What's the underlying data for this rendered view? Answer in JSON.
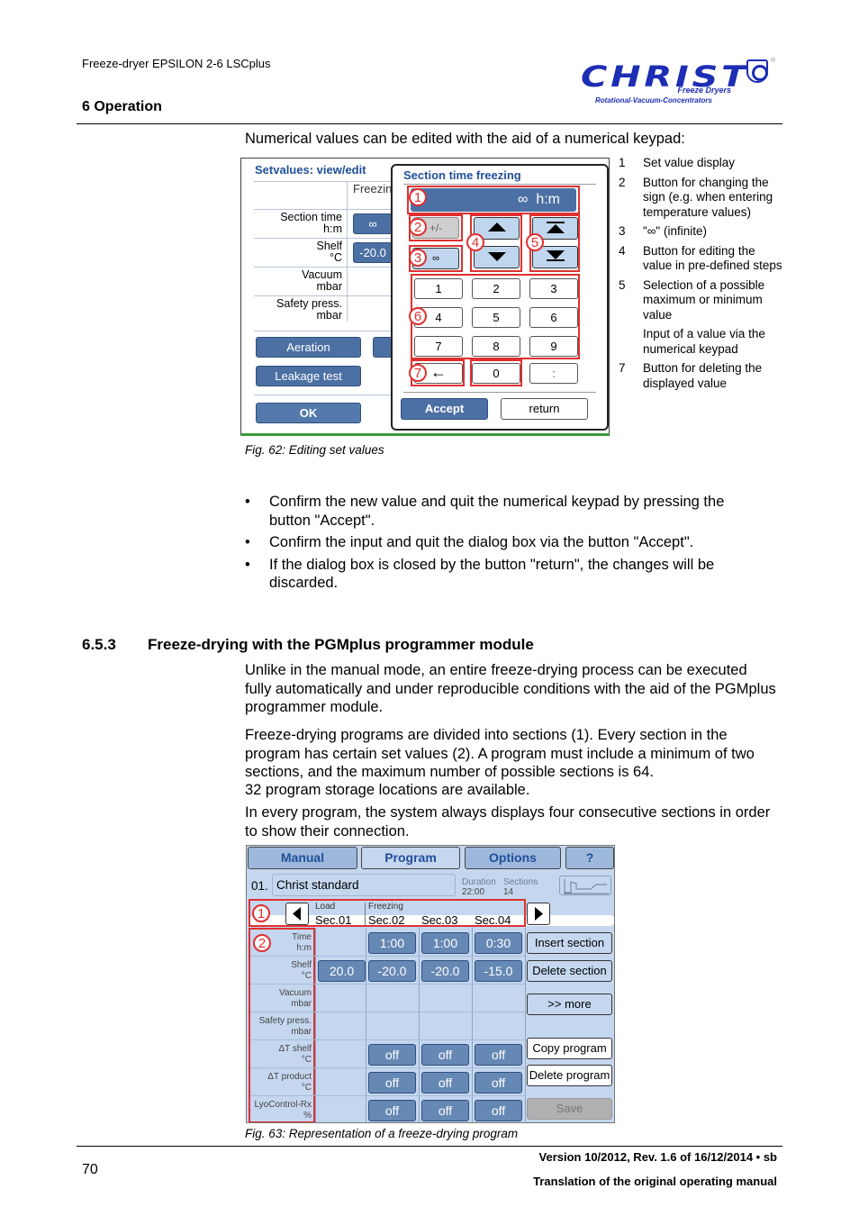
{
  "header": {
    "doc_title": "Freeze-dryer EPSILON 2-6 LSCplus",
    "section": "6 Operation",
    "logo": {
      "word": "CHRIST",
      "line1": "Freeze Dryers",
      "line2": "Rotational-Vacuum-Concentrators",
      "reg": "®"
    }
  },
  "intro": "Numerical values can be edited with the aid of a numerical keypad:",
  "fig62": {
    "setvalues_title": "Setvalues: view/edit",
    "column_header": "Freezin",
    "rows": [
      {
        "label1": "Section time",
        "label2": "h:m",
        "value": "∞"
      },
      {
        "label1": "Shelf",
        "label2": "°C",
        "value": "-20.0"
      },
      {
        "label1": "Vacuum",
        "label2": "mbar",
        "value": ""
      },
      {
        "label1": "Safety press.",
        "label2": "mbar",
        "value": ""
      }
    ],
    "aeration": "Aeration",
    "leakage_test": "Leakage test",
    "ok": "OK",
    "dialog": {
      "title": "Section time freezing",
      "display_value": "∞",
      "display_unit": "h:m",
      "sign_btn": "+/-",
      "infinite_btn": "∞",
      "keys": [
        "1",
        "2",
        "3",
        "4",
        "5",
        "6",
        "7",
        "8",
        "9"
      ],
      "zero": "0",
      "colon": ":",
      "accept": "Accept",
      "return": "return"
    },
    "callouts": [
      "1",
      "2",
      "3",
      "4",
      "5",
      "6",
      "7"
    ],
    "caption": "Fig. 62: Editing set values"
  },
  "legend": [
    {
      "n": "1",
      "text": "Set value display"
    },
    {
      "n": "2",
      "text": "Button for changing the sign (e.g. when entering temperature values)"
    },
    {
      "n": "3",
      "text": "\"∞\" (infinite)"
    },
    {
      "n": "4",
      "text": "Button for editing the value in pre-defined steps"
    },
    {
      "n": "5",
      "text": "Selection of a possible maximum or minimum value"
    },
    {
      "n": "",
      "text": "Input of a value via the numerical keypad"
    },
    {
      "n": "7",
      "text": "Button for deleting the displayed value"
    }
  ],
  "bullets": [
    "Confirm the new value and quit the numerical keypad by pressing the button \"Accept\".",
    "Confirm the input and quit the dialog box via the button \"Accept\".",
    "If the dialog box is closed by the button \"return\", the changes will be discarded."
  ],
  "section653": {
    "number": "6.5.3",
    "title": "Freeze-drying with the PGMplus programmer module",
    "paragraphs": [
      "Unlike in the manual mode, an entire freeze-drying process can be executed fully automatically and under reproducible conditions with the aid of the PGMplus programmer module.",
      "Freeze-drying programs are divided into sections (1). Every section in the program has certain set values (2). A program must include a minimum of two sections, and the maximum number of possible sections is 64.",
      "32 program storage locations are available.",
      "In every program, the system always displays four consecutive sections in order to show their connection."
    ]
  },
  "fig63": {
    "tabs": [
      "Manual",
      "Program",
      "Options",
      "?"
    ],
    "active_tab": "Program",
    "program_number": "01.",
    "program_name": "Christ standard",
    "duration_label": "Duration",
    "duration_value": "22:00",
    "sections_label": "Sections",
    "sections_value": "14",
    "phase_headers": [
      "Load",
      "Freezing"
    ],
    "sections": [
      "Sec.01",
      "Sec.02",
      "Sec.03",
      "Sec.04"
    ],
    "rows": [
      {
        "label1": "Time",
        "label2": "h:m",
        "values": [
          "",
          "1:00",
          "1:00",
          "0:30"
        ]
      },
      {
        "label1": "Shelf",
        "label2": "°C",
        "values": [
          "20.0",
          "-20.0",
          "-20.0",
          "-15.0"
        ]
      },
      {
        "label1": "Vacuum",
        "label2": "mbar",
        "values": [
          "",
          "",
          "",
          ""
        ]
      },
      {
        "label1": "Safety press.",
        "label2": "mbar",
        "values": [
          "",
          "",
          "",
          ""
        ]
      },
      {
        "label1": "ΔT shelf",
        "label2": "°C",
        "values": [
          "",
          "off",
          "off",
          "off"
        ]
      },
      {
        "label1": "ΔT product",
        "label2": "°C",
        "values": [
          "",
          "off",
          "off",
          "off"
        ]
      },
      {
        "label1": "LyoControl-Rx",
        "label2": "%",
        "values": [
          "",
          "off",
          "off",
          "off"
        ]
      }
    ],
    "side_buttons": {
      "insert": "Insert section",
      "delete": "Delete section",
      "more": ">> more",
      "copy": "Copy program",
      "delete_program": "Delete program",
      "save": "Save"
    },
    "callouts": [
      "1",
      "2"
    ],
    "caption": "Fig. 63: Representation of a freeze-drying program"
  },
  "footer": {
    "page": "70",
    "version": "Version 10/2012, Rev. 1.6 of 16/12/2014 • sb",
    "translation": "Translation of the original operating manual"
  }
}
